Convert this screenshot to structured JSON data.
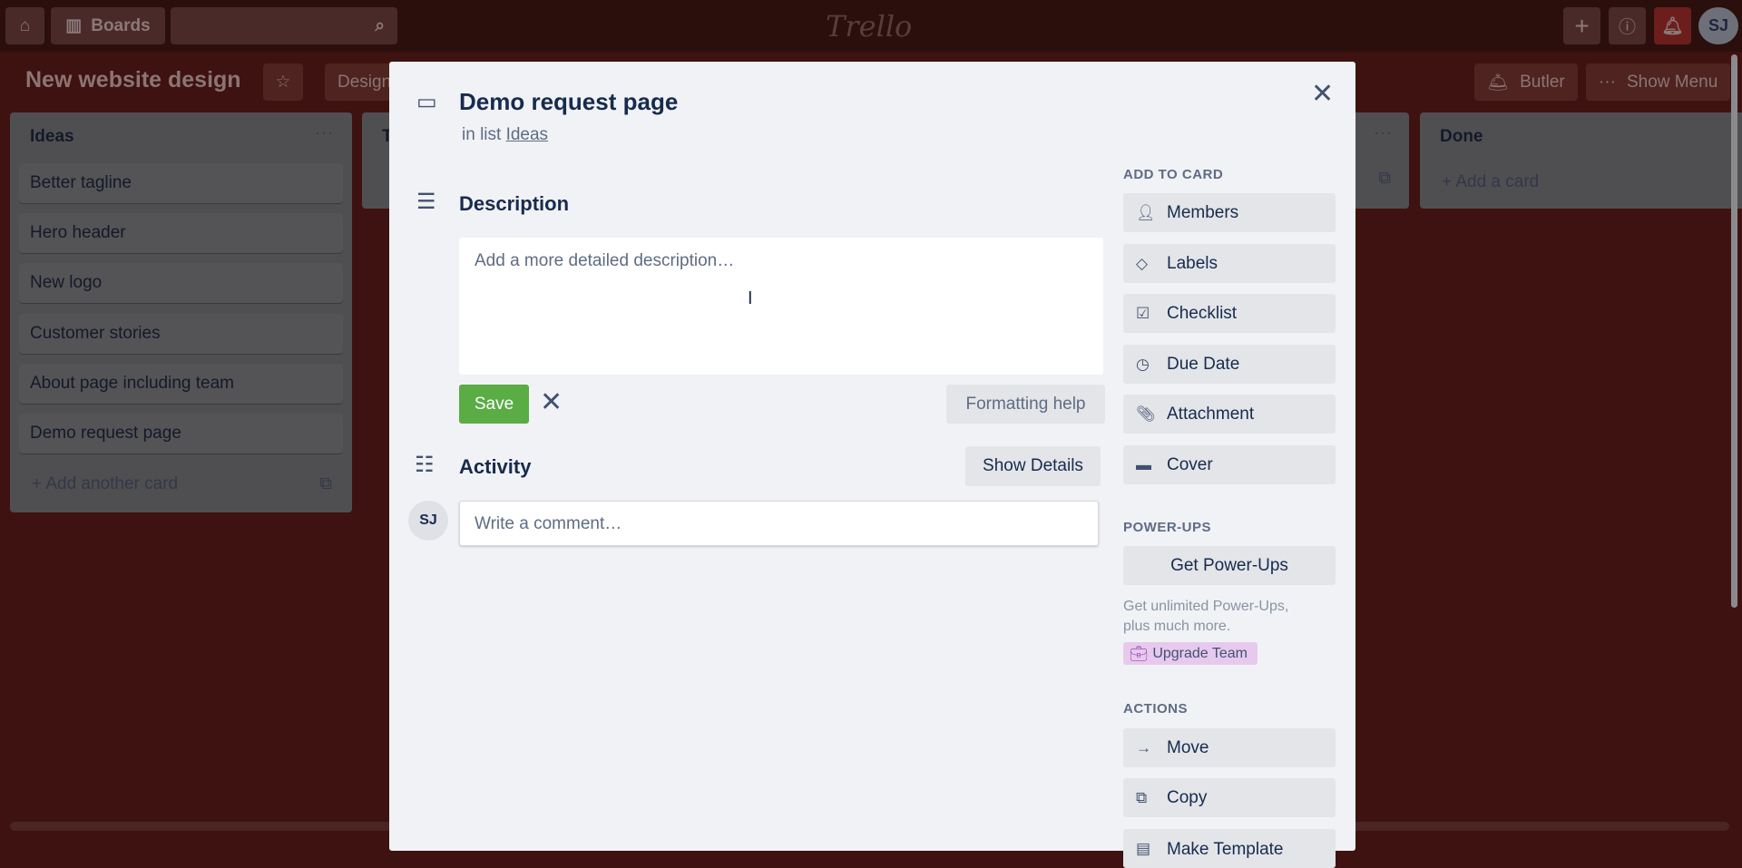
{
  "topbar": {
    "boards_label": "Boards",
    "logo": "Trello",
    "avatar": "SJ",
    "icons": [
      "home-icon",
      "boards-icon",
      "search-icon",
      "plus-icon",
      "info-icon",
      "bell-icon"
    ]
  },
  "board": {
    "title": "New website design",
    "team_btn": "Design",
    "butler": "Butler",
    "show_menu": "Show Menu"
  },
  "lists": [
    {
      "title": "Ideas",
      "cards": [
        "Better tagline",
        "Hero header",
        "New logo",
        "Customer stories",
        "About page including team",
        "Demo request page"
      ],
      "add": "Add another card"
    },
    {
      "title": "T"
    },
    {
      "title": "Done",
      "add": "Add a card"
    }
  ],
  "card_modal": {
    "title": "Demo request page",
    "in_list_prefix": "in list",
    "list_name": "Ideas",
    "description_heading": "Description",
    "description_placeholder": "Add a more detailed description…",
    "save": "Save",
    "formatting_help": "Formatting help",
    "activity_heading": "Activity",
    "show_details": "Show Details",
    "comment_avatar": "SJ",
    "comment_placeholder": "Write a comment…",
    "add_to_card_heading": "ADD TO CARD",
    "add_to_card": [
      {
        "label": "Members",
        "icon": "person-icon"
      },
      {
        "label": "Labels",
        "icon": "tag-icon"
      },
      {
        "label": "Checklist",
        "icon": "checklist-icon"
      },
      {
        "label": "Due Date",
        "icon": "clock-icon"
      },
      {
        "label": "Attachment",
        "icon": "paperclip-icon"
      },
      {
        "label": "Cover",
        "icon": "cover-icon"
      }
    ],
    "powerups_heading": "POWER-UPS",
    "get_powerups": "Get Power-Ups",
    "powerups_text_1": "Get unlimited Power-Ups,",
    "powerups_text_2": "plus much more.",
    "upgrade_team": "Upgrade Team",
    "actions_heading": "ACTIONS",
    "actions": [
      {
        "label": "Move",
        "icon": "arrow-right-icon"
      },
      {
        "label": "Copy",
        "icon": "copy-icon"
      },
      {
        "label": "Make Template",
        "icon": "template-icon"
      }
    ]
  }
}
